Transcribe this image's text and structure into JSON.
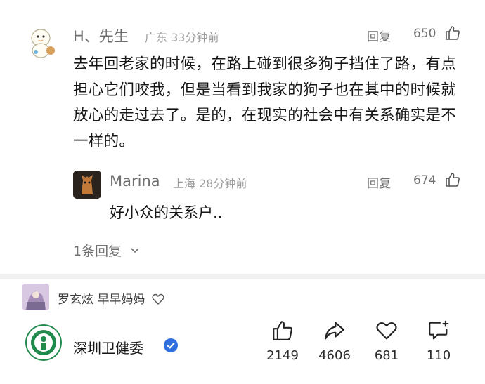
{
  "comment": {
    "username": "H、先生",
    "location": "广东",
    "time": "33分钟前",
    "reply_label": "回复",
    "like_count": "650",
    "text": "去年回老家的时候，在路上碰到很多狗子挡住了路，有点担心它们咬我，但是当看到我家的狗子也在其中的时候就放心的走过去了。是的，在现实的社会中有关系确实是不一样的。"
  },
  "reply": {
    "username": "Marina",
    "location": "上海",
    "time": "28分钟前",
    "reply_label": "回复",
    "like_count": "674",
    "text": "好小众的关系户.."
  },
  "more_replies": "1条回复",
  "liker": {
    "text": "罗玄炫  早早妈妈"
  },
  "account": {
    "name": "深圳卫健委"
  },
  "actions": {
    "like": "2149",
    "share": "4606",
    "favorite": "681",
    "comment": "110"
  },
  "colors": {
    "verify_blue": "#2f6fde",
    "meta_gray": "#9d9d9d"
  }
}
